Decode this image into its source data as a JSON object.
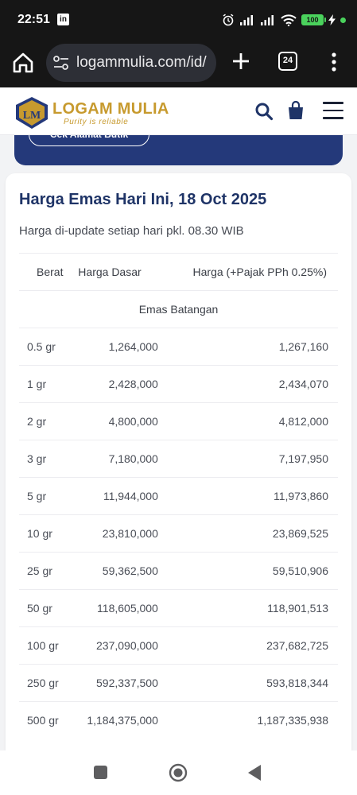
{
  "status_bar": {
    "time": "22:51",
    "linkedin_glyph": "in",
    "battery": "100",
    "icons": [
      "linkedin-icon",
      "alarm-icon",
      "signal-icon",
      "signal-icon",
      "wifi-icon",
      "battery-icon",
      "charging-icon"
    ]
  },
  "browser": {
    "url": "logammulia.com/id/",
    "tab_count": "24"
  },
  "site": {
    "brand": "LOGAM MULIA",
    "tagline": "Purity is reliable",
    "logo_mark": "LM",
    "brand_color": "#c79a2e",
    "primary_color": "#1f3467"
  },
  "banner": {
    "button_label": "Cek Alamat Butik"
  },
  "prices": {
    "title": "Harga Emas Hari Ini, 18 Oct 2025",
    "subtitle": "Harga di-update setiap hari pkl. 08.30 WIB",
    "columns": [
      "Berat",
      "Harga Dasar",
      "Harga (+Pajak PPh 0.25%)"
    ],
    "group_label": "Emas Batangan",
    "rows": [
      {
        "weight": "0.5 gr",
        "base": "1,264,000",
        "with_tax": "1,267,160"
      },
      {
        "weight": "1 gr",
        "base": "2,428,000",
        "with_tax": "2,434,070"
      },
      {
        "weight": "2 gr",
        "base": "4,800,000",
        "with_tax": "4,812,000"
      },
      {
        "weight": "3 gr",
        "base": "7,180,000",
        "with_tax": "7,197,950"
      },
      {
        "weight": "5 gr",
        "base": "11,944,000",
        "with_tax": "11,973,860"
      },
      {
        "weight": "10 gr",
        "base": "23,810,000",
        "with_tax": "23,869,525"
      },
      {
        "weight": "25 gr",
        "base": "59,362,500",
        "with_tax": "59,510,906"
      },
      {
        "weight": "50 gr",
        "base": "118,605,000",
        "with_tax": "118,901,513"
      },
      {
        "weight": "100 gr",
        "base": "237,090,000",
        "with_tax": "237,682,725"
      },
      {
        "weight": "250 gr",
        "base": "592,337,500",
        "with_tax": "593,818,344"
      },
      {
        "weight": "500 gr",
        "base": "1,184,375,000",
        "with_tax": "1,187,335,938"
      }
    ]
  }
}
